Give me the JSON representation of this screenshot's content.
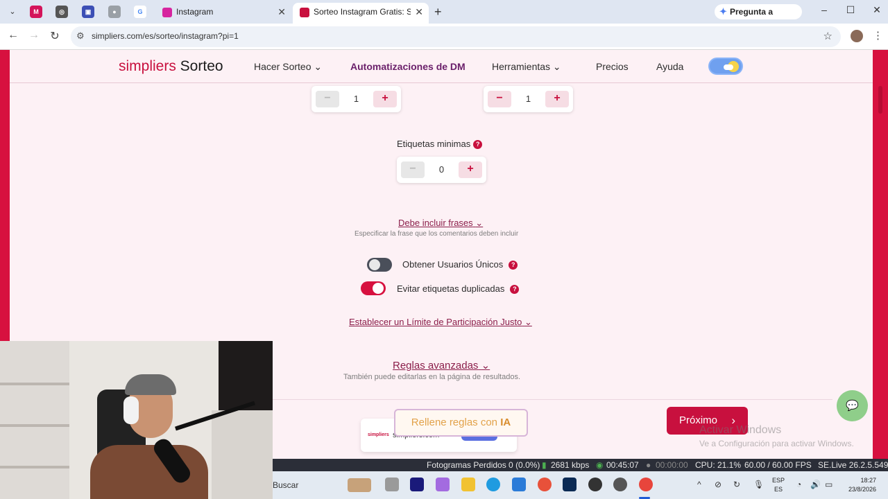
{
  "browser": {
    "tabs": [
      {
        "title": "Instagram",
        "favicon_color": "#d6249f"
      },
      {
        "title": "Sorteo Instagram Gratis: Sortea",
        "favicon_color": "#c8103e"
      }
    ],
    "gemini_label": "Pregunta a Gemini",
    "url": "simpliers.com/es/sorteo/instagram?pi=1"
  },
  "site": {
    "logo_brand": "simpliers",
    "logo_product": " Sorteo",
    "nav": {
      "hacer_sorteo": "Hacer Sorteo",
      "automatizaciones": "Automatizaciones de DM",
      "herramientas": "Herramientas",
      "precios": "Precios",
      "ayuda": "Ayuda"
    }
  },
  "form": {
    "stepper_top_left_value": "1",
    "stepper_top_right_value": "1",
    "etiquetas_label": "Etiquetas minimas",
    "etiquetas_value": "0",
    "frases_link": "Debe incluir frases",
    "frases_sub": "Especificar la frase que los comentarios deben incluir",
    "unicos_label": "Obtener Usuarios Únicos",
    "unicos_on": false,
    "duplicadas_label": "Evitar etiquetas duplicadas",
    "duplicadas_on": true,
    "limite_link": "Establecer un Límite de Participación Justo",
    "reglas_link": "Reglas avanzadas",
    "reglas_sub": "También puede editarlas en la página de resultados."
  },
  "actions": {
    "ia_text": "Rellene reglas con ",
    "ia_bold": "IA",
    "next_label": "Próximo"
  },
  "promo": {
    "logo": "simpliers",
    "text": "simpliers.com"
  },
  "watermark": {
    "line1": "Activar Windows",
    "line2": "Ve a Configuración para activar Windows."
  },
  "obs": {
    "frames_lost": "Fotogramas Perdidos 0 (0.0%)",
    "bitrate": "2681 kbps",
    "stream_time": "00:45:07",
    "rec_time": "00:00:00",
    "cpu": "CPU: 21.1%",
    "fps": "60.00 / 60.00 FPS",
    "version": "SE.Live 26.2.5.549"
  },
  "taskbar": {
    "search": "Buscar",
    "lang_top": "ESP",
    "lang_bottom": "ES",
    "time": "18:27",
    "date": "23/8/2026"
  },
  "colors": {
    "brand": "#c8103e",
    "page_bg": "#fdf1f5",
    "dm_nav": "#6a1f6a",
    "chat_bubble": "#8fce8a"
  }
}
